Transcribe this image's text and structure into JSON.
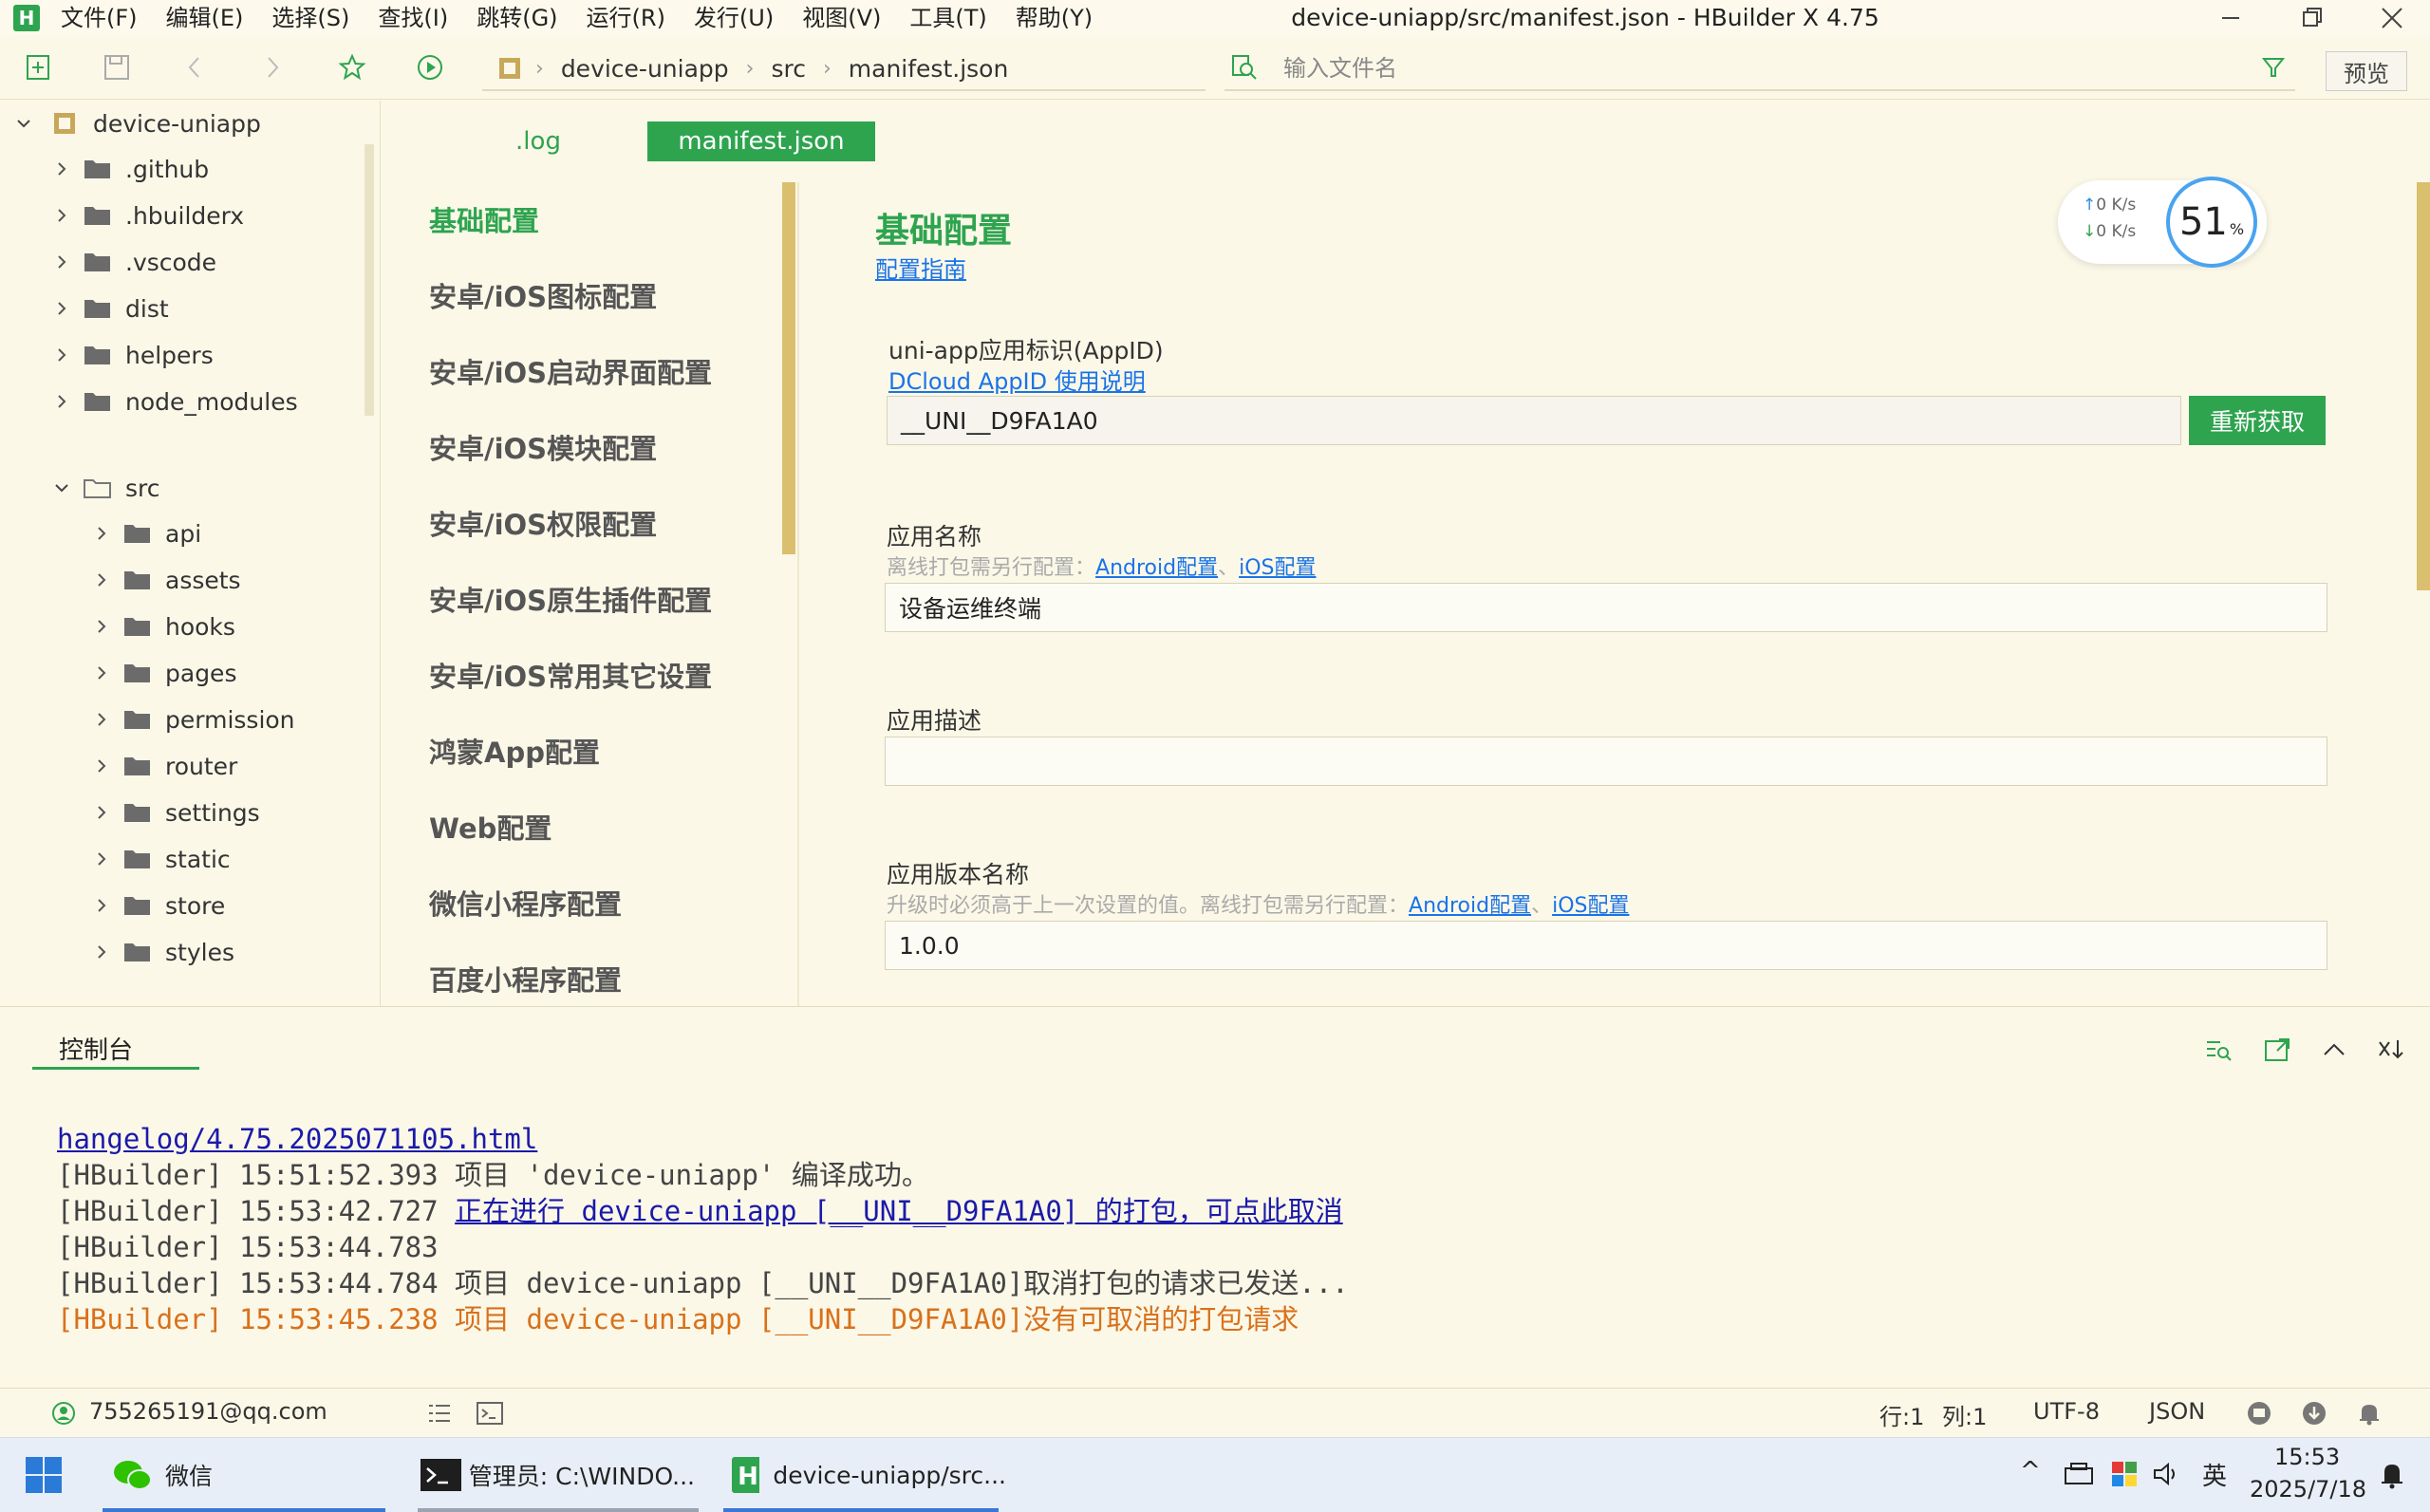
{
  "app": {
    "logo_letter": "H",
    "window_title": "device-uniapp/src/manifest.json - HBuilder X 4.75"
  },
  "menu": [
    "文件(F)",
    "编辑(E)",
    "选择(S)",
    "查找(I)",
    "跳转(G)",
    "运行(R)",
    "发行(U)",
    "视图(V)",
    "工具(T)",
    "帮助(Y)"
  ],
  "toolbar": {
    "breadcrumb": [
      "device-uniapp",
      "src",
      "manifest.json"
    ],
    "search_placeholder": "输入文件名",
    "preview_label": "预览"
  },
  "tree": {
    "root": "device-uniapp",
    "top_folders": [
      ".github",
      ".hbuilderx",
      ".vscode",
      "dist",
      "helpers",
      "node_modules"
    ],
    "src_folder": "src",
    "src_children": [
      "api",
      "assets",
      "hooks",
      "pages",
      "permission",
      "router",
      "settings",
      "static",
      "store",
      "styles"
    ]
  },
  "editor": {
    "tabs": [
      ".log",
      "manifest.json"
    ],
    "nav": [
      "基础配置",
      "安卓/iOS图标配置",
      "安卓/iOS启动界面配置",
      "安卓/iOS模块配置",
      "安卓/iOS权限配置",
      "安卓/iOS原生插件配置",
      "安卓/iOS常用其它设置",
      "鸿蒙App配置",
      "Web配置",
      "微信小程序配置",
      "百度小程序配置"
    ],
    "section_title": "基础配置",
    "guide_link": "配置指南",
    "appid": {
      "label": "uni-app应用标识(AppID)",
      "help_link": "DCloud AppID 使用说明",
      "value": "__UNI__D9FA1A0",
      "refresh_button": "重新获取"
    },
    "app_name": {
      "label": "应用名称",
      "hint": "离线打包需另行配置：",
      "android_link": "Android配置",
      "sep": "、",
      "ios_link": "iOS配置",
      "value": "设备运维终端"
    },
    "app_desc": {
      "label": "应用描述",
      "value": ""
    },
    "version_name": {
      "label": "应用版本名称",
      "hint": "升级时必须高于上一次设置的值。离线打包需另行配置：",
      "android_link": "Android配置",
      "sep": "、",
      "ios_link": "iOS配置",
      "value": "1.0.0"
    }
  },
  "speed_widget": {
    "upload": "0  K/s",
    "download": "0  K/s",
    "percent": "51",
    "percent_sign": "%"
  },
  "console": {
    "tab": "控制台",
    "lines": [
      {
        "text": "hangelog/4.75.2025071105.html"
      },
      {
        "prefix": "[HBuilder] 15:51:52.393 ",
        "text": "项目 'device-uniapp' 编译成功。"
      },
      {
        "prefix": "[HBuilder] 15:53:42.727 ",
        "text": "正在进行 device-uniapp [__UNI__D9FA1A0] 的打包，可点此取消"
      },
      {
        "prefix": "[HBuilder] 15:53:44.783",
        "text": ""
      },
      {
        "prefix": "[HBuilder] 15:53:44.784 ",
        "text": "项目 device-uniapp [__UNI__D9FA1A0]取消打包的请求已发送..."
      },
      {
        "prefix": "[HBuilder] 15:53:45.238 ",
        "text": "项目 device-uniapp [__UNI__D9FA1A0]没有可取消的打包请求"
      }
    ]
  },
  "statusbar": {
    "user": "755265191@qq.com",
    "row": "行:1",
    "col": "列:1",
    "encoding": "UTF-8",
    "language": "JSON"
  },
  "taskbar": {
    "tasks": [
      "微信",
      "管理员: C:\\WINDO...",
      "device-uniapp/src..."
    ],
    "ime": "英",
    "time": "15:53",
    "date": "2025/7/18"
  },
  "colors": {
    "accent": "#2ea44f",
    "background": "#fbf8e8",
    "link": "#1a73e8",
    "warning": "#d9711b",
    "scrollbar": "#d9bf6e"
  }
}
